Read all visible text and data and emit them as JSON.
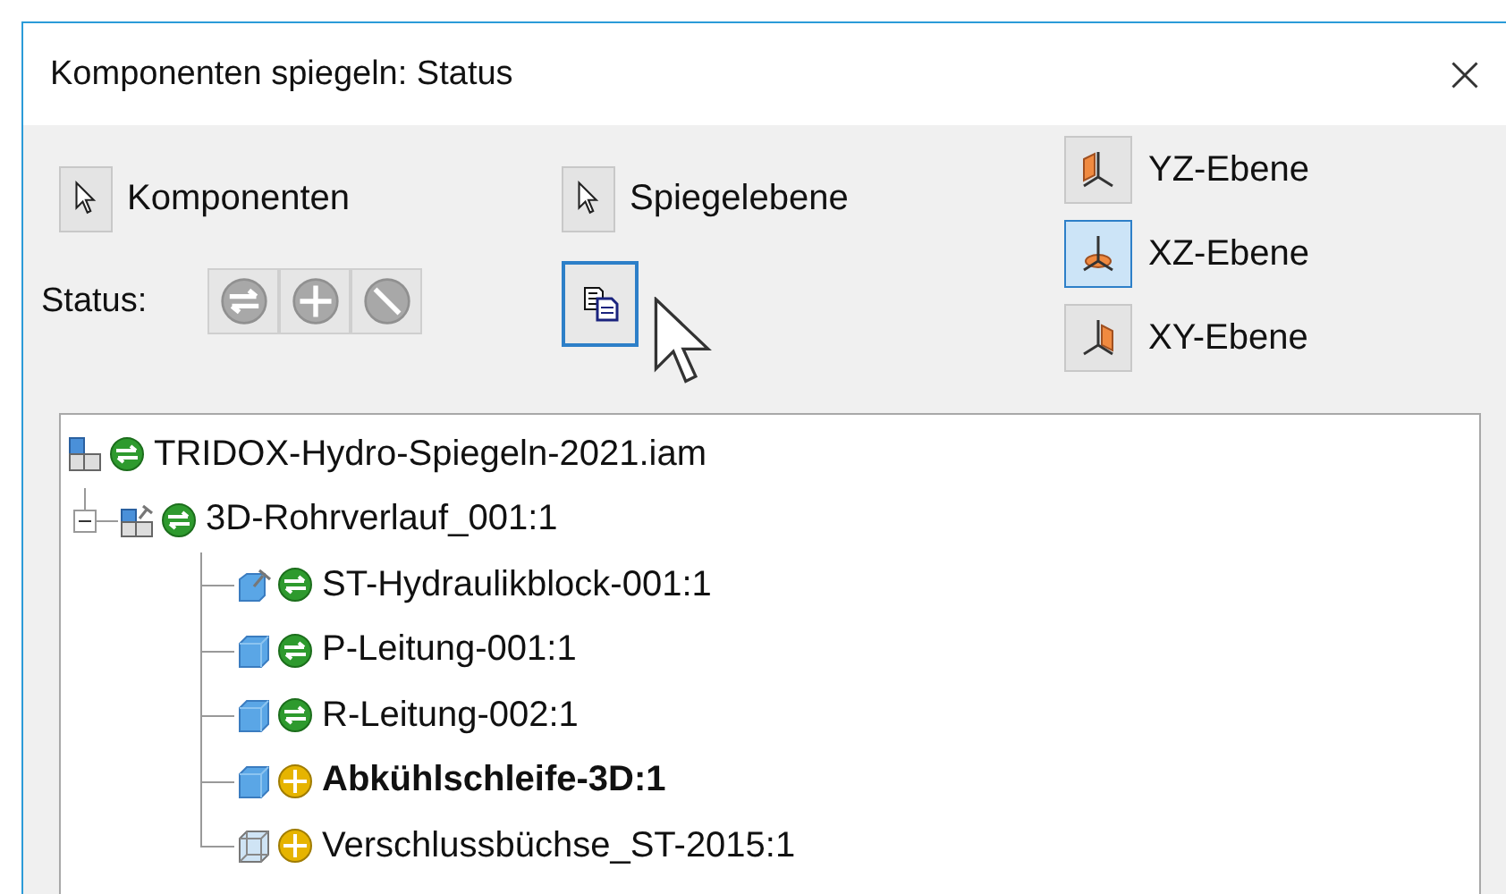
{
  "window": {
    "title": "Komponenten spiegeln: Status"
  },
  "selectors": [
    {
      "label": "Komponenten"
    },
    {
      "label": "Spiegelebene"
    }
  ],
  "status": {
    "label": "Status:",
    "buttons": [
      {
        "kind": "mirror",
        "disabled": true
      },
      {
        "kind": "reuse",
        "disabled": true
      },
      {
        "kind": "exclude",
        "disabled": true
      }
    ]
  },
  "copy_button": {
    "focused": true
  },
  "planes": [
    {
      "label": "YZ-Ebene",
      "kind": "yz",
      "selected": false
    },
    {
      "label": "XZ-Ebene",
      "kind": "xz",
      "selected": true
    },
    {
      "label": "XY-Ebene",
      "kind": "xy",
      "selected": false
    }
  ],
  "tree": [
    {
      "name": "TRIDOX-Hydro-Spiegeln-2021.iam",
      "kind": "assembly",
      "mirrored": true,
      "bold": false,
      "children": [
        {
          "name": "3D-Rohrverlauf_001:1",
          "kind": "subassembly",
          "mirrored": true,
          "bold": false,
          "expanded": true,
          "children": [
            {
              "name": "ST-Hydraulikblock-001:1",
              "kind": "part-pinned",
              "mirrored": true,
              "bold": false
            },
            {
              "name": "P-Leitung-001:1",
              "kind": "part",
              "mirrored": true,
              "bold": false
            },
            {
              "name": "R-Leitung-002:1",
              "kind": "part",
              "mirrored": true,
              "bold": false
            },
            {
              "name": "Abkühlschleife-3D:1",
              "kind": "part",
              "mirrored": false,
              "bold": true
            },
            {
              "name": "Verschlussbüchse_ST-2015:1",
              "kind": "part-hollow",
              "mirrored": false,
              "bold": false
            }
          ]
        }
      ]
    }
  ]
}
